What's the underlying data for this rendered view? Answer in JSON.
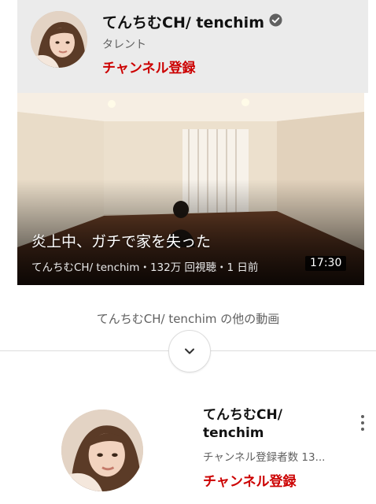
{
  "channel": {
    "name": "てんちむCH/ tenchim",
    "category": "タレント",
    "subscribe_label": "チャンネル登録",
    "verified_icon": "verified-check-icon"
  },
  "video": {
    "title": "炎上中、ガチで家を失った",
    "meta": "てんちむCH/ tenchim・132万 回視聴・1 日前",
    "duration": "17:30"
  },
  "more_videos": {
    "heading": "てんちむCH/ tenchim の他の動画",
    "expand_icon": "chevron-down-icon"
  },
  "channel_card": {
    "name": "てんちむCH/ tenchim",
    "subscribers": "チャンネル登録者数 13...",
    "subscribe_label": "チャンネル登録",
    "menu_icon": "more-vert-icon"
  },
  "colors": {
    "accent_red": "#cc0000",
    "header_bg": "#ebebeb",
    "secondary_text": "#606060"
  }
}
